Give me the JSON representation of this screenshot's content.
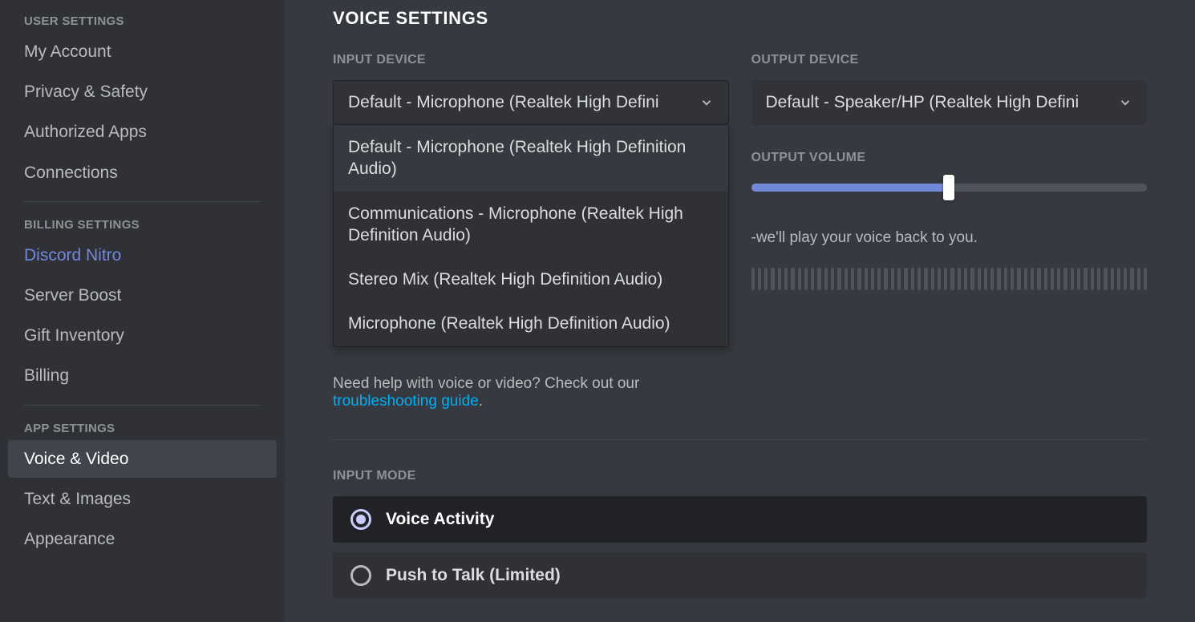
{
  "sidebar": {
    "sections": {
      "user": {
        "header": "USER SETTINGS",
        "items": [
          "My Account",
          "Privacy & Safety",
          "Authorized Apps",
          "Connections"
        ]
      },
      "billing": {
        "header": "BILLING SETTINGS",
        "items": [
          "Discord Nitro",
          "Server Boost",
          "Gift Inventory",
          "Billing"
        ]
      },
      "app": {
        "header": "APP SETTINGS",
        "items": [
          "Voice & Video",
          "Text & Images",
          "Appearance"
        ]
      }
    }
  },
  "page": {
    "title": "VOICE SETTINGS",
    "input_device": {
      "label": "INPUT DEVICE",
      "selected": "Default - Microphone (Realtek High Defini",
      "options": [
        "Default - Microphone (Realtek High Definition Audio)",
        "Communications - Microphone (Realtek High Definition Audio)",
        "Stereo Mix (Realtek High Definition Audio)",
        "Microphone (Realtek High Definition Audio)"
      ]
    },
    "output_device": {
      "label": "OUTPUT DEVICE",
      "selected": "Default - Speaker/HP (Realtek High Defini"
    },
    "output_volume": {
      "label": "OUTPUT VOLUME",
      "percent": 50
    },
    "mic_test_partial": "-we'll play your voice back to you.",
    "help": {
      "prefix": "Need help with voice or video? Check out our ",
      "link": "troubleshooting guide",
      "suffix": "."
    },
    "input_mode": {
      "label": "INPUT MODE",
      "options": [
        "Voice Activity",
        "Push to Talk (Limited)"
      ],
      "selected_index": 0
    }
  }
}
